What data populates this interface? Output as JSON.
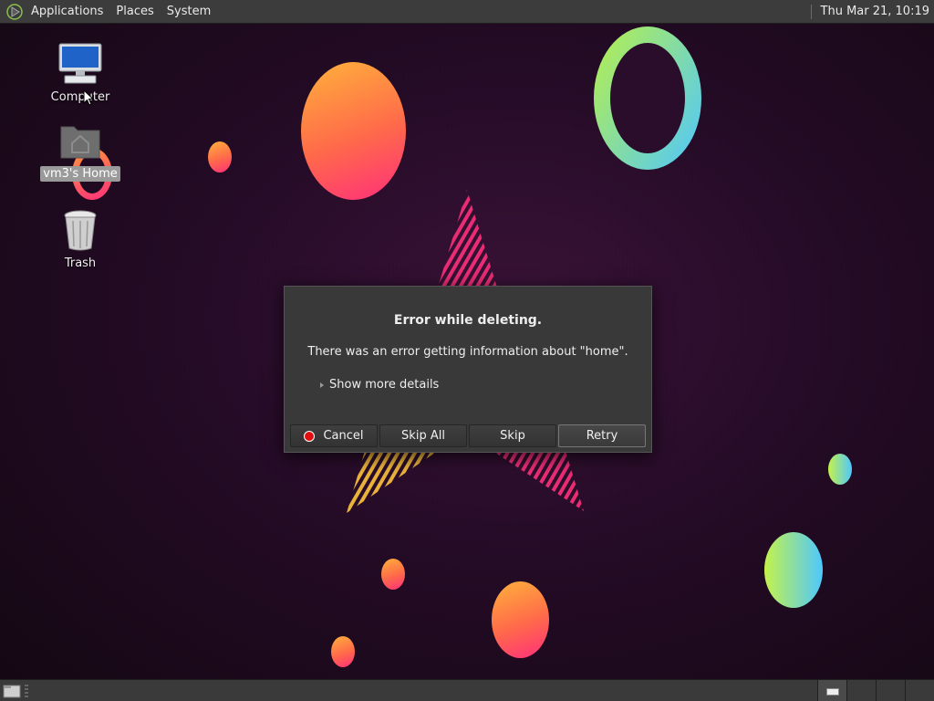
{
  "top_panel": {
    "menus": [
      "Applications",
      "Places",
      "System"
    ],
    "clock": "Thu Mar 21, 10:19",
    "logo_icon": "mate-logo-icon"
  },
  "desktop": {
    "icons": [
      {
        "label": "Computer",
        "icon": "computer-icon"
      },
      {
        "label": "vm3's Home",
        "icon": "home-folder-icon",
        "selected": true
      },
      {
        "label": "Trash",
        "icon": "trash-icon"
      }
    ]
  },
  "dialog": {
    "title": "Error while deleting.",
    "message": "There was an error getting information about \"home\".",
    "details_label": "Show more details",
    "buttons": {
      "cancel": "Cancel",
      "skip_all": "Skip All",
      "skip": "Skip",
      "retry": "Retry"
    },
    "default_button": "retry"
  },
  "bottom_panel": {
    "workspace_count": 4,
    "active_workspace": 1
  },
  "colors": {
    "panel": "#3c3c3c",
    "dialog_bg": "#393939",
    "wallpaper_base": "#240b26",
    "accent_warm": "#ff6a4a",
    "accent_cool": "#4fc7ff",
    "cancel_red": "#e01010"
  }
}
